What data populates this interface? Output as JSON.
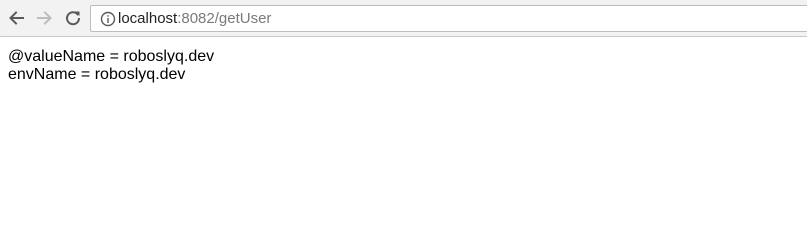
{
  "toolbar": {
    "back_icon": "back-arrow-icon",
    "forward_icon": "forward-arrow-icon",
    "reload_icon": "reload-icon"
  },
  "address_bar": {
    "info_icon": "info-icon",
    "host": "localhost",
    "rest": ":8082/getUser"
  },
  "content": {
    "lines": [
      "@valueName = roboslyq.dev",
      "envName = roboslyq.dev"
    ]
  }
}
